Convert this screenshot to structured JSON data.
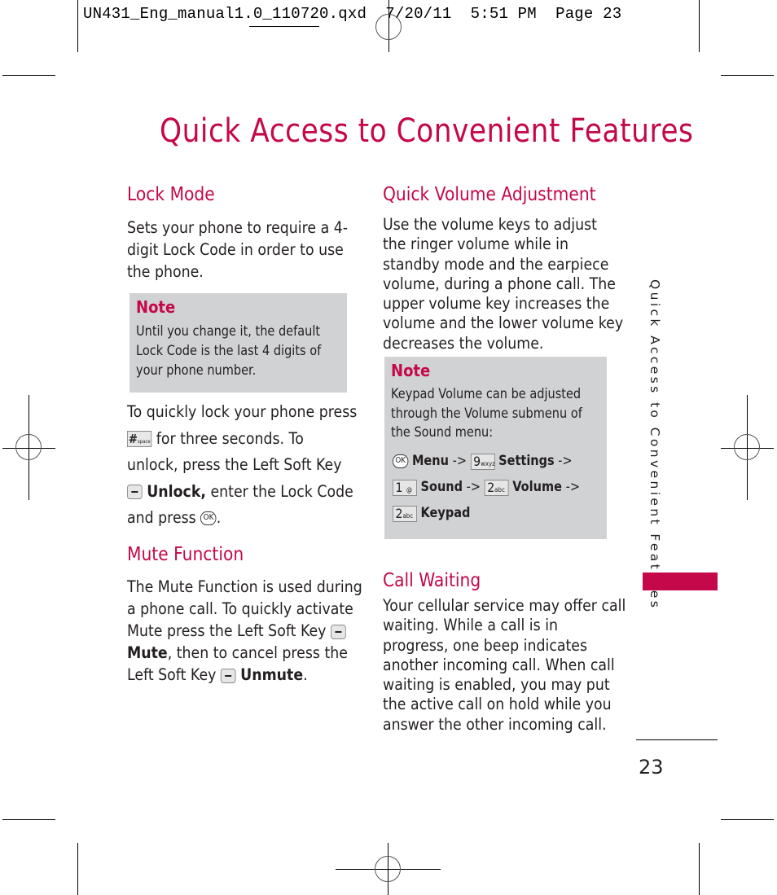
{
  "slug": "UN431_Eng_manual1.0_110720.qxd  7/20/11  5:51 PM  Page 23",
  "title": "Quick Access to Convenient Features",
  "left_column": {
    "lock_mode": {
      "heading": "Lock Mode",
      "intro_lines": [
        "Sets your phone to require a 4-",
        "digit Lock Code in order to use",
        "the phone."
      ],
      "note": {
        "title": "Note",
        "lines": [
          "Until you change it, the default",
          "Lock Code is the last 4 digits of",
          "your phone number."
        ]
      },
      "instructions": {
        "l1": "To quickly lock your phone press",
        "hash_key": "#",
        "hash_key_sub": "space",
        "l2": "for three seconds. To",
        "l3": "unlock, press the Left Soft Key",
        "unlock_label": "Unlock,",
        "l4": "enter the Lock Code",
        "l5": "and press",
        "ok_key": "OK",
        "l5_end": "."
      }
    },
    "mute_function": {
      "heading": "Mute Function",
      "l1": "The Mute Function is used during",
      "l2": "a phone call. To quickly activate",
      "l3": "Mute press the Left Soft Key",
      "mute_label": "Mute",
      "l4": ", then to cancel press the",
      "l5": "Left Soft Key",
      "unmute_label": "Unmute",
      "l5_end": "."
    }
  },
  "right_column": {
    "quick_volume": {
      "heading": "Quick Volume Adjustment",
      "lines": [
        "Use the volume keys to adjust",
        "the ringer volume while in",
        "standby mode and the earpiece",
        "volume, during a phone call. The",
        "upper volume key increases the",
        "volume and the lower volume key",
        "decreases the volume."
      ],
      "note": {
        "title": "Note",
        "lines": [
          "Keypad Volume can be adjusted",
          "through the Volume submenu of",
          "the Sound menu:"
        ],
        "path": {
          "ok_key": "OK",
          "menu": "Menu",
          "arrow": "->",
          "key9": "9",
          "key9_sub": "wxyz",
          "settings": "Settings",
          "key1": "1",
          "key1_sub": "@",
          "sound": "Sound",
          "key2": "2",
          "key2_sub": "abc",
          "volume": "Volume",
          "keypad": "Keypad"
        }
      }
    },
    "call_waiting": {
      "heading": "Call Waiting",
      "lines": [
        "Your cellular service may offer call",
        "waiting. While a call is in",
        "progress, one beep indicates",
        "another incoming call. When call",
        "waiting is enabled, you may put",
        "the active call on hold while you",
        "answer the other incoming call."
      ]
    }
  },
  "side_tab": {
    "label": "Quick Access to Convenient Features",
    "accent": "#c4084a"
  },
  "page_number": "23",
  "colors": {
    "accent": "#c4084a",
    "note_bg": "#d1d2d4",
    "text": "#231f20"
  }
}
